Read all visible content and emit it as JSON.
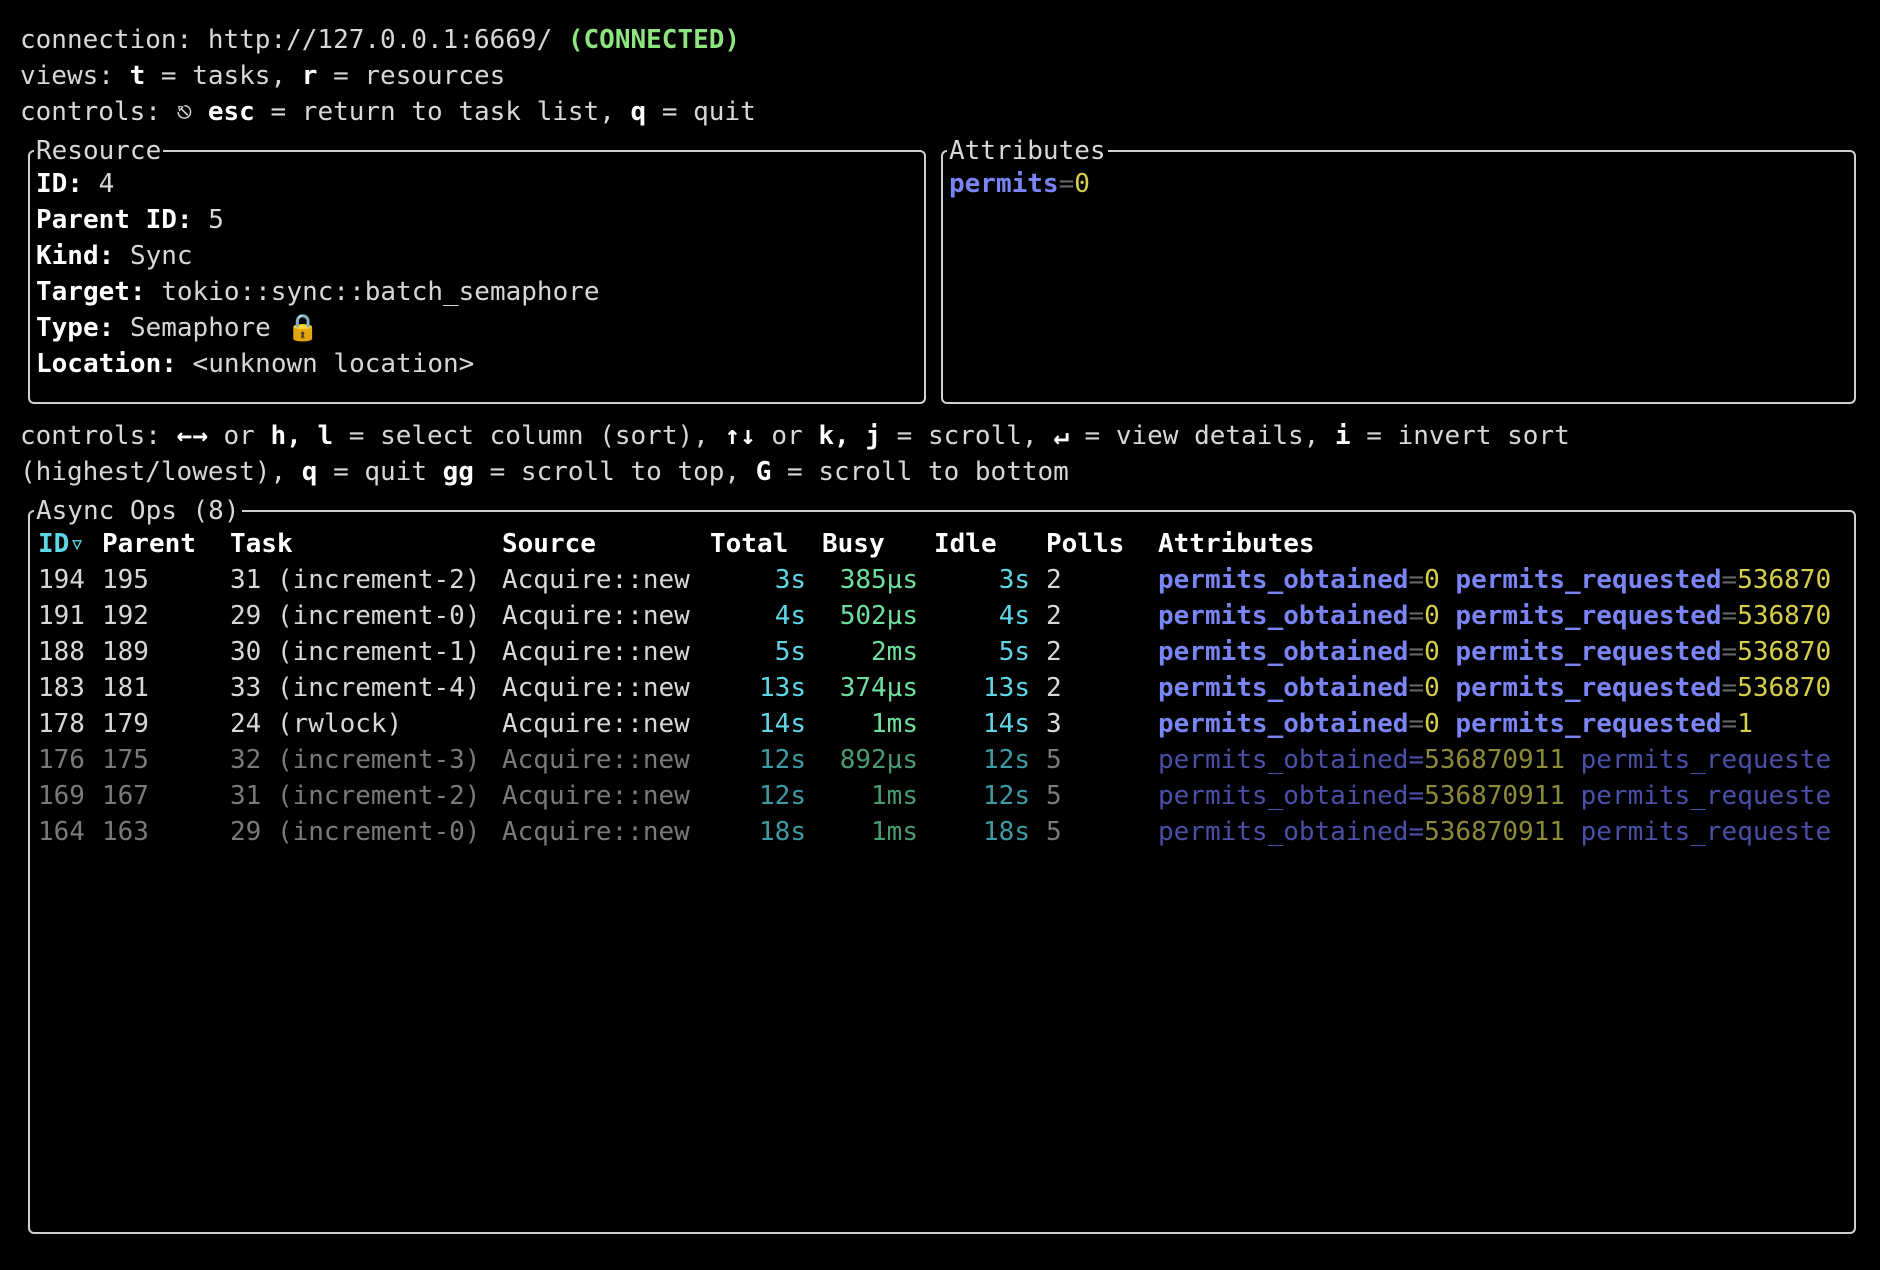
{
  "header": {
    "connection_label": "connection: ",
    "connection_url": "http://127.0.0.1:6669/",
    "connection_status": "(CONNECTED)",
    "views_prefix": "views: ",
    "views_key_t": "t",
    "views_t_desc": " = tasks, ",
    "views_key_r": "r",
    "views_r_desc": " = resources",
    "controls_prefix": "controls: ",
    "controls_icon": "⎋",
    "controls_key_esc": "esc",
    "controls_esc_desc": " = return to task list, ",
    "controls_key_q": "q",
    "controls_q_desc": " = quit"
  },
  "resource_panel": {
    "title": "Resource",
    "id_label": "ID:",
    "id_value": "4",
    "parent_label": "Parent ID:",
    "parent_value": "5",
    "kind_label": "Kind:",
    "kind_value": "Sync",
    "target_label": "Target:",
    "target_value": "tokio::sync::batch_semaphore",
    "type_label": "Type:",
    "type_value": "Semaphore",
    "type_icon": "🔒",
    "location_label": "Location:",
    "location_value": "<unknown location>"
  },
  "attributes_panel": {
    "title": "Attributes",
    "attr_key": "permits",
    "attr_eq": "=",
    "attr_value": "0"
  },
  "controls2": {
    "line1": [
      {
        "t": "controls: ",
        "b": false
      },
      {
        "t": "←→",
        "b": true
      },
      {
        "t": " or ",
        "b": false
      },
      {
        "t": "h, l",
        "b": true
      },
      {
        "t": " = select column (sort), ",
        "b": false
      },
      {
        "t": "↑↓",
        "b": true
      },
      {
        "t": " or ",
        "b": false
      },
      {
        "t": "k, j",
        "b": true
      },
      {
        "t": " = scroll, ",
        "b": false
      },
      {
        "t": "↵",
        "b": true
      },
      {
        "t": " = view details, ",
        "b": false
      },
      {
        "t": "i",
        "b": true
      },
      {
        "t": " = invert sort",
        "b": false
      }
    ],
    "line2": [
      {
        "t": "(highest/lowest), ",
        "b": false
      },
      {
        "t": "q",
        "b": true
      },
      {
        "t": " = quit ",
        "b": false
      },
      {
        "t": "gg",
        "b": true
      },
      {
        "t": " = scroll to top, ",
        "b": false
      },
      {
        "t": "G",
        "b": true
      },
      {
        "t": " = scroll to bottom",
        "b": false
      }
    ]
  },
  "async_ops": {
    "title": "Async Ops (8)",
    "columns": [
      "ID▿",
      "Parent",
      "Task",
      "Source",
      "Total",
      "Busy",
      "Idle",
      "Polls",
      "Attributes"
    ],
    "rows": [
      {
        "id": "194",
        "parent": "195",
        "task": "31 (increment-2)",
        "source": "Acquire::new",
        "total": "3s",
        "busy": "385µs",
        "idle": "3s",
        "polls": "2",
        "k1": "permits_obtained",
        "v1": "0",
        "k2": "permits_requested",
        "v2": "536870",
        "dim": false
      },
      {
        "id": "191",
        "parent": "192",
        "task": "29 (increment-0)",
        "source": "Acquire::new",
        "total": "4s",
        "busy": "502µs",
        "idle": "4s",
        "polls": "2",
        "k1": "permits_obtained",
        "v1": "0",
        "k2": "permits_requested",
        "v2": "536870",
        "dim": false
      },
      {
        "id": "188",
        "parent": "189",
        "task": "30 (increment-1)",
        "source": "Acquire::new",
        "total": "5s",
        "busy": "2ms",
        "idle": "5s",
        "polls": "2",
        "k1": "permits_obtained",
        "v1": "0",
        "k2": "permits_requested",
        "v2": "536870",
        "dim": false
      },
      {
        "id": "183",
        "parent": "181",
        "task": "33 (increment-4)",
        "source": "Acquire::new",
        "total": "13s",
        "busy": "374µs",
        "idle": "13s",
        "polls": "2",
        "k1": "permits_obtained",
        "v1": "0",
        "k2": "permits_requested",
        "v2": "536870",
        "dim": false
      },
      {
        "id": "178",
        "parent": "179",
        "task": "24 (rwlock)",
        "source": "Acquire::new",
        "total": "14s",
        "busy": "1ms",
        "idle": "14s",
        "polls": "3",
        "k1": "permits_obtained",
        "v1": "0",
        "k2": "permits_requested",
        "v2": "1",
        "dim": false
      },
      {
        "id": "176",
        "parent": "175",
        "task": "32 (increment-3)",
        "source": "Acquire::new",
        "total": "12s",
        "busy": "892µs",
        "idle": "12s",
        "polls": "5",
        "k1": "permits_obtained",
        "v1": "536870911",
        "k2": "permits_requeste",
        "v2": "",
        "dim": true
      },
      {
        "id": "169",
        "parent": "167",
        "task": "31 (increment-2)",
        "source": "Acquire::new",
        "total": "12s",
        "busy": "1ms",
        "idle": "12s",
        "polls": "5",
        "k1": "permits_obtained",
        "v1": "536870911",
        "k2": "permits_requeste",
        "v2": "",
        "dim": true
      },
      {
        "id": "164",
        "parent": "163",
        "task": "29 (increment-0)",
        "source": "Acquire::new",
        "total": "18s",
        "busy": "1ms",
        "idle": "18s",
        "polls": "5",
        "k1": "permits_obtained",
        "v1": "536870911",
        "k2": "permits_requeste",
        "v2": "",
        "dim": true
      }
    ]
  },
  "colors": {
    "connected": "#8ee57f",
    "attr_key": "#7b84f5",
    "attr_value": "#d8d04a",
    "sorted_column": "#5fd7e6",
    "duration": "#5fd7e6",
    "busy": "#6fe0a0"
  }
}
